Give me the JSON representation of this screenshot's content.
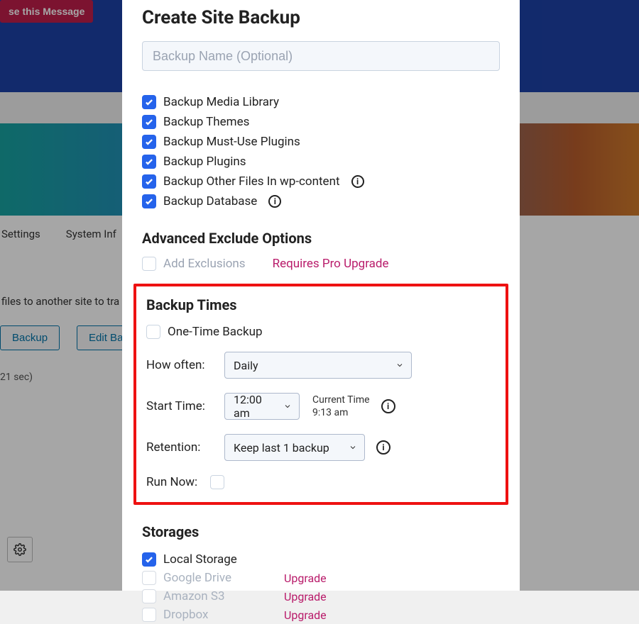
{
  "bg": {
    "close_msg": "se this Message",
    "tab_settings": "Settings",
    "tab_system": "System Inf",
    "transfer_text": "files to another site to tra",
    "btn_backup": "Backup",
    "btn_edit": "Edit Back",
    "duration": "21 sec)"
  },
  "modal": {
    "title": "Create Site Backup",
    "name_placeholder": "Backup Name (Optional)",
    "checks": {
      "media": "Backup Media Library",
      "themes": "Backup Themes",
      "mu_plugins": "Backup Must-Use Plugins",
      "plugins": "Backup Plugins",
      "wp_content": "Backup Other Files In wp-content",
      "database": "Backup Database"
    },
    "advanced": {
      "title": "Advanced Exclude Options",
      "add_exclusions": "Add Exclusions",
      "requires_pro": "Requires Pro Upgrade"
    },
    "times": {
      "title": "Backup Times",
      "one_time": "One-Time Backup",
      "how_often_label": "How often:",
      "how_often_value": "Daily",
      "start_time_label": "Start Time:",
      "start_time_value": "12:00 am",
      "current_time_label": "Current Time",
      "current_time_value": "9:13 am",
      "retention_label": "Retention:",
      "retention_value": "Keep last 1 backup",
      "run_now_label": "Run Now:"
    },
    "storages": {
      "title": "Storages",
      "local": "Local Storage",
      "gdrive": "Google Drive",
      "s3": "Amazon S3",
      "dropbox": "Dropbox",
      "upgrade": "Upgrade"
    }
  }
}
